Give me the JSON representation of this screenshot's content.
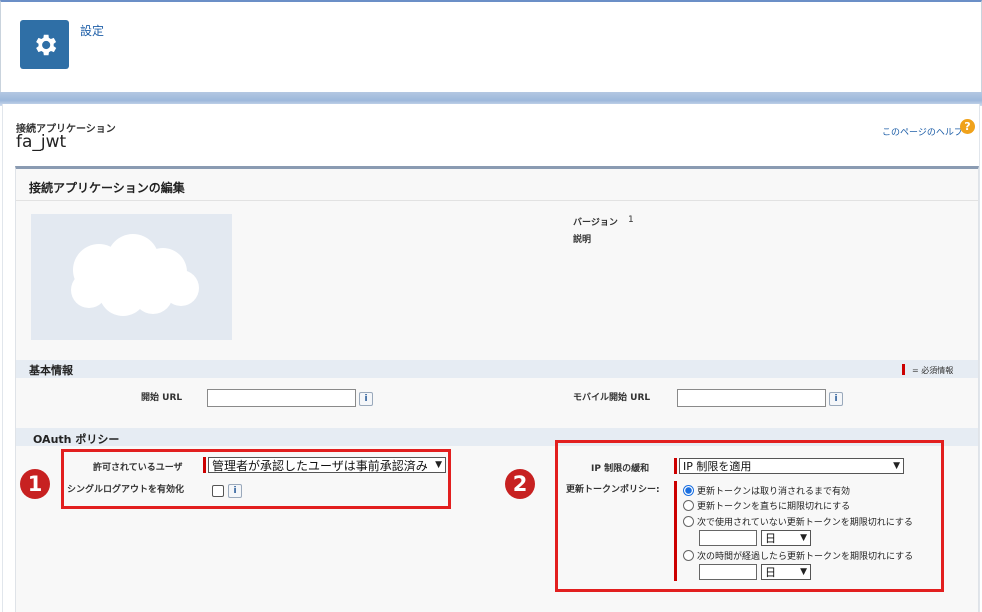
{
  "header": {
    "setup_link": "設定",
    "gear_icon": "gear-icon"
  },
  "page": {
    "type_label": "接続アプリケーション",
    "title": "fa_jwt",
    "help_link": "このページのヘルプ",
    "help_icon": "?"
  },
  "edit": {
    "title": "接続アプリケーションの編集",
    "version_label": "バージョン",
    "version_value": "1",
    "description_label": "説明"
  },
  "basic": {
    "title": "基本情報",
    "required_note": "= 必須情報",
    "start_url_label": "開始 URL",
    "start_url_value": "",
    "mobile_start_url_label": "モバイル開始 URL",
    "mobile_start_url_value": "",
    "info_icon": "i"
  },
  "oauth": {
    "title": "OAuth ポリシー",
    "permitted_users_label": "許可されているユーザ",
    "permitted_users_value": "管理者が承認したユーザは事前承認済み",
    "single_logout_label": "シングルログアウトを有効化",
    "ip_relax_label": "IP 制限の緩和",
    "ip_relax_value": "IP 制限を適用",
    "refresh_policy_label": "更新トークンポリシー:",
    "refresh_options": [
      "更新トークンは取り消されるまで有効",
      "更新トークンを直ちに期限切れにする",
      "次で使用されていない更新トークンを期限切れにする",
      "次の時間が経過したら更新トークンを期限切れにする"
    ],
    "refresh_selected_index": 0,
    "unit_value_1": "",
    "unit_select_1": "日",
    "unit_value_2": "",
    "unit_select_2": "日"
  },
  "callouts": {
    "badge_1": "1",
    "badge_2": "2"
  },
  "colors": {
    "accent": "#2f6fa6",
    "highlight": "#e21f1f",
    "required": "#cc0000"
  }
}
